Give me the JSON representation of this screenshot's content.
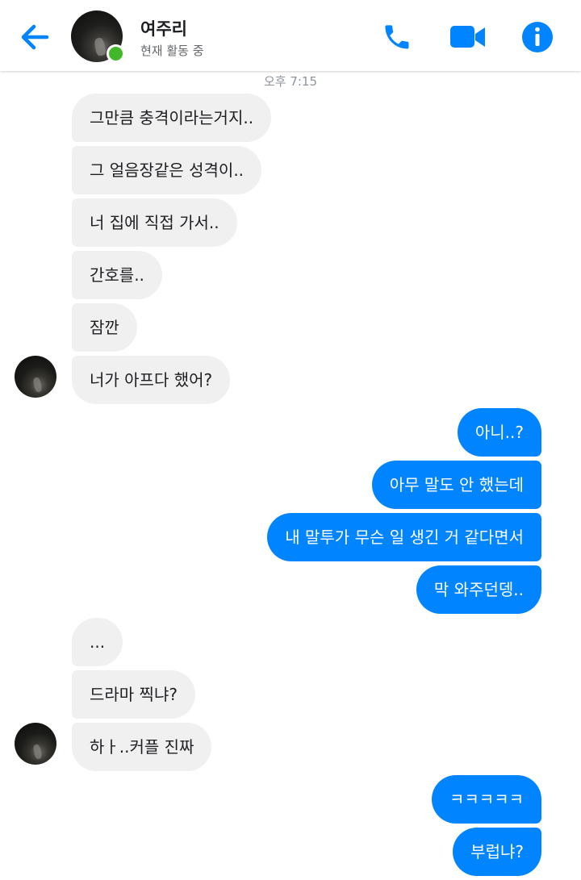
{
  "header": {
    "contact_name": "여주리",
    "status": "현재 활동 중",
    "accent_color": "#0084ff",
    "online_color": "#42b72a",
    "icons": [
      "back-arrow-icon",
      "phone-icon",
      "video-camera-icon",
      "info-icon"
    ]
  },
  "conversation": {
    "timestamp": "오후 7:15",
    "messages": [
      {
        "sender": "contact",
        "text": "그만큼 충격이라는거지.."
      },
      {
        "sender": "contact",
        "text": "그 얼음장같은 성격이.."
      },
      {
        "sender": "contact",
        "text": "너 집에 직접 가서.."
      },
      {
        "sender": "contact",
        "text": "간호를.."
      },
      {
        "sender": "contact",
        "text": "잠깐"
      },
      {
        "sender": "contact",
        "text": "너가 아프다 했어?"
      },
      {
        "sender": "me",
        "text": "아니..?"
      },
      {
        "sender": "me",
        "text": "아무 말도 안 했는데"
      },
      {
        "sender": "me",
        "text": "내 말투가 무슨 일 생긴 거 같다면서"
      },
      {
        "sender": "me",
        "text": "막 와주던뎅.."
      },
      {
        "sender": "contact",
        "text": "..."
      },
      {
        "sender": "contact",
        "text": "드라마 찍냐?"
      },
      {
        "sender": "contact",
        "text": "하ㅏ..커플 진짜"
      },
      {
        "sender": "me",
        "text": "ㅋㅋㅋㅋㅋ"
      },
      {
        "sender": "me",
        "text": "부럽냐?"
      }
    ]
  }
}
